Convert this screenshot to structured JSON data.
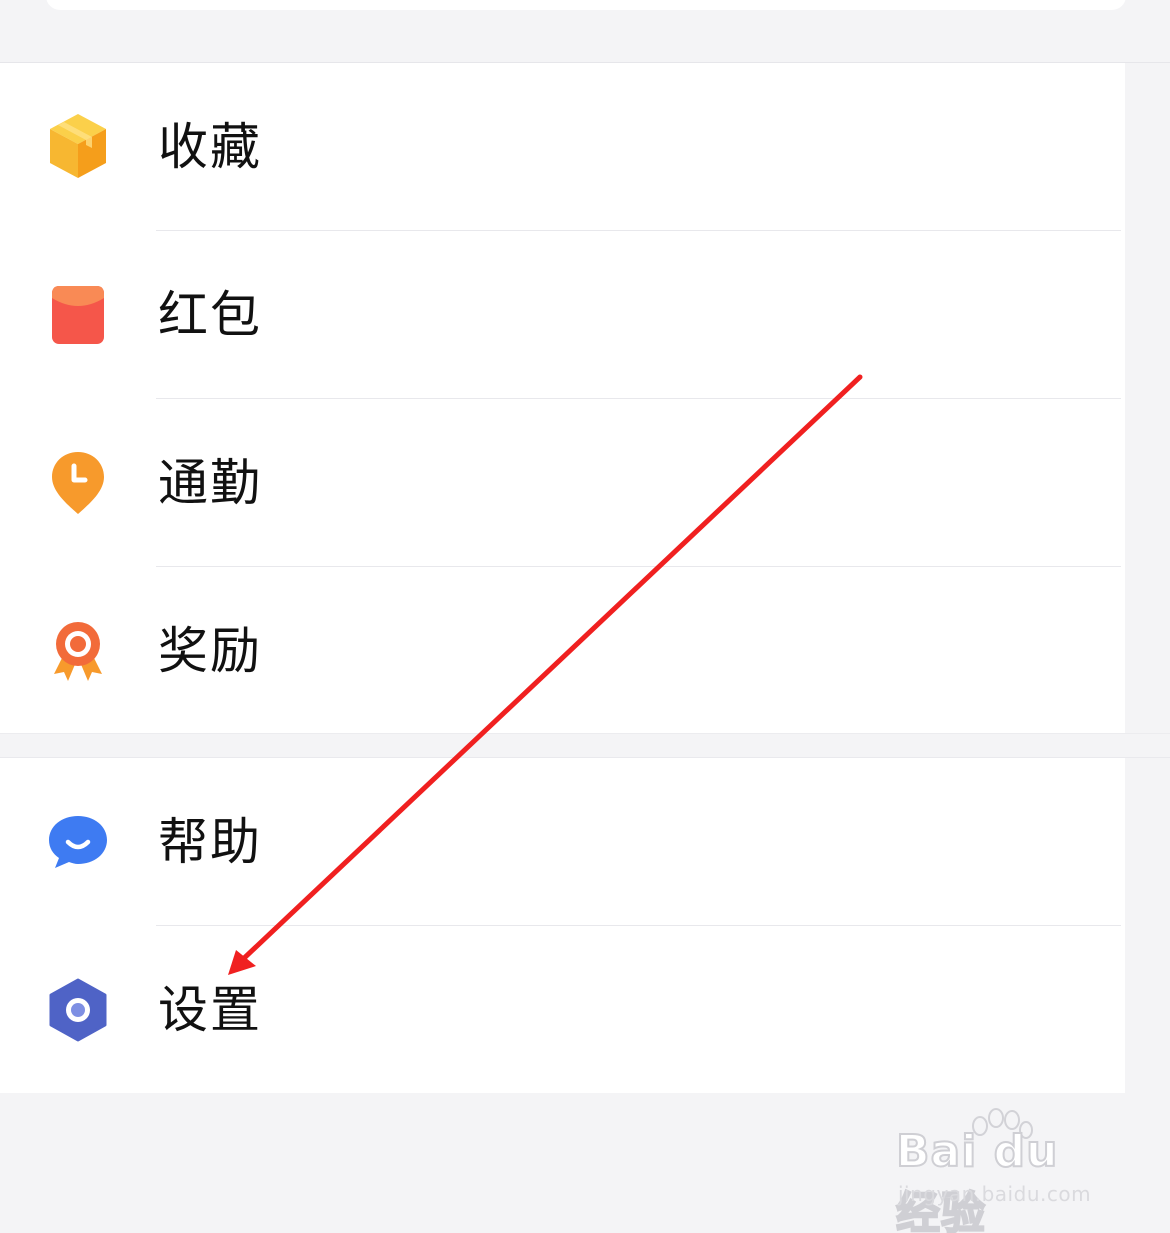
{
  "menu": {
    "group1": [
      {
        "label": "收藏",
        "icon": "favorites-box-icon",
        "color": "#F7B731"
      },
      {
        "label": "红包",
        "icon": "red-envelope-icon",
        "color": "#F5564A"
      },
      {
        "label": "通勤",
        "icon": "commute-clock-icon",
        "color": "#F79A2C"
      },
      {
        "label": "奖励",
        "icon": "reward-medal-icon",
        "color": "#F26B3A"
      }
    ],
    "group2": [
      {
        "label": "帮助",
        "icon": "help-chat-icon",
        "color": "#3E7BF2"
      },
      {
        "label": "设置",
        "icon": "settings-hexagon-icon",
        "color": "#4F63C6"
      }
    ]
  },
  "annotation": {
    "color": "#F02020"
  },
  "watermark": {
    "logo": "Bai du 经验",
    "url": "jingyan.baidu.com"
  }
}
